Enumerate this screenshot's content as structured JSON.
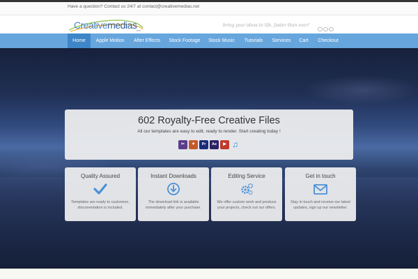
{
  "topbar": {
    "text": "Have a question? Contact us 24/7 at contact@creativemedias.net"
  },
  "header": {
    "logo_text_a": "Creative",
    "logo_text_b": "medias",
    "logo_sub": ".net",
    "tagline": "bring your ideas to life, faster than ever!",
    "brand_icons": [
      "espn-icon",
      "tv-icon",
      "cbs-icon"
    ]
  },
  "nav": {
    "items": [
      {
        "label": "Home",
        "active": true
      },
      {
        "label": "Apple Motion"
      },
      {
        "label": "After Effects"
      },
      {
        "label": "Stock Footage"
      },
      {
        "label": "Stock Music"
      },
      {
        "label": "Tutorials"
      },
      {
        "label": "Services"
      },
      {
        "label": "Cart"
      },
      {
        "label": "Checkout"
      }
    ]
  },
  "banner": {
    "title": "602 Royalty-Free Creative Files",
    "subtitle": "All our templates are easy to edit, ready to render. Start creating today !",
    "app_icons": [
      {
        "name": "final-cut-icon",
        "color": "#5a3c8a",
        "glyph": "✂"
      },
      {
        "name": "motion-icon",
        "color": "#c45a2a",
        "glyph": "✦"
      },
      {
        "name": "premiere-icon",
        "color": "#1c2a7a",
        "glyph": "Pr"
      },
      {
        "name": "after-effects-icon",
        "color": "#2b2263",
        "glyph": "Ae"
      },
      {
        "name": "video-icon",
        "color": "#c0392b",
        "glyph": "▶"
      },
      {
        "name": "music-icon",
        "color": "#2f8fd8",
        "glyph": "♫"
      }
    ]
  },
  "cards": [
    {
      "title": "Quality Assured",
      "icon": "checkmark-icon",
      "text": "Templates are ready to customize, documentation is included."
    },
    {
      "title": "Instant Downloads",
      "icon": "download-icon",
      "text": "The download link is available immediately after your purchase."
    },
    {
      "title": "Editing Service",
      "icon": "gears-icon",
      "text": "We offer custom work and produce your projects, check out our offers."
    },
    {
      "title": "Get in touch",
      "icon": "envelope-icon",
      "text": "Stay in touch and receive our latest updates, sign up our newsletter."
    }
  ],
  "colors": {
    "accent": "#4a90d9",
    "nav": "#67a6dd",
    "nav_active": "#3e86c8"
  }
}
